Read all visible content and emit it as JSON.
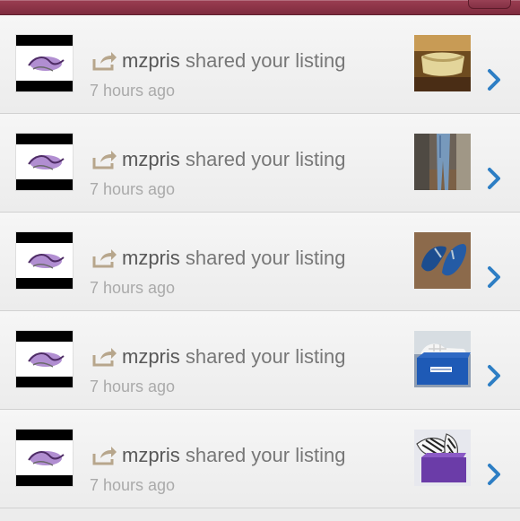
{
  "notifications": [
    {
      "user": "mzpris",
      "action": "shared your listing",
      "time": "7 hours ago",
      "thumbnail": "gold-clutch"
    },
    {
      "user": "mzpris",
      "action": "shared your listing",
      "time": "7 hours ago",
      "thumbnail": "jeans"
    },
    {
      "user": "mzpris",
      "action": "shared your listing",
      "time": "7 hours ago",
      "thumbnail": "blue-flip-flops"
    },
    {
      "user": "mzpris",
      "action": "shared your listing",
      "time": "7 hours ago",
      "thumbnail": "sneakers-box"
    },
    {
      "user": "mzpris",
      "action": "shared your listing",
      "time": "7 hours ago",
      "thumbnail": "heels-box"
    }
  ],
  "colors": {
    "topbar": "#8f3549",
    "username": "#585858",
    "action": "#777777",
    "timestamp": "#aaaaaa",
    "share_icon": "#b7a68c",
    "chevron": "#2d7ec4"
  },
  "icons": {
    "share": "share-arrow-icon",
    "chevron": "chevron-right-icon"
  }
}
